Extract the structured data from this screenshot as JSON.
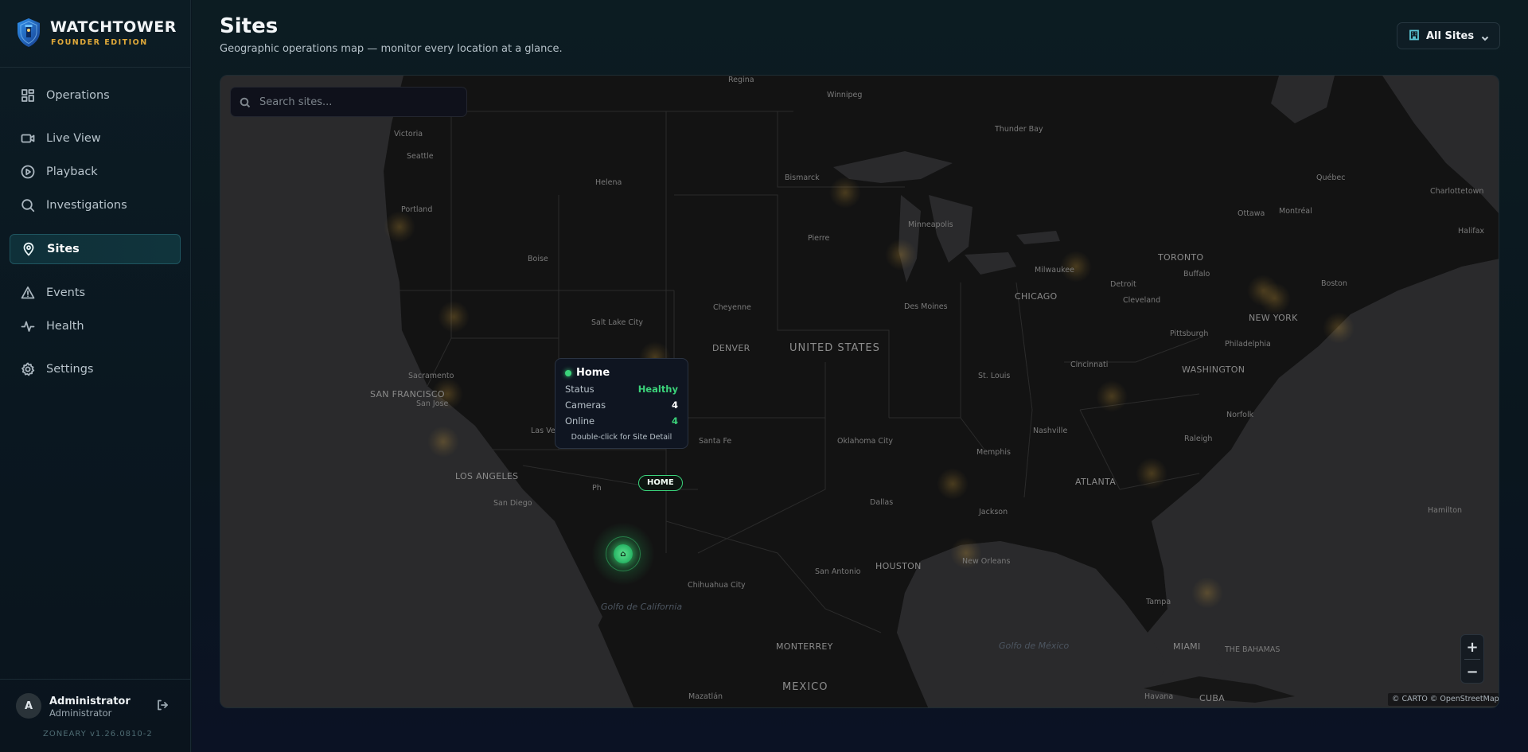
{
  "brand": {
    "name": "WATCHTOWER",
    "edition": "FOUNDER EDITION"
  },
  "nav": {
    "items": [
      {
        "label": "Operations",
        "icon": "grid-icon"
      },
      {
        "label": "Live View",
        "icon": "video-camera-icon"
      },
      {
        "label": "Playback",
        "icon": "play-circle-icon"
      },
      {
        "label": "Investigations",
        "icon": "search-icon"
      },
      {
        "label": "Sites",
        "icon": "map-pin-icon",
        "active": true
      },
      {
        "label": "Events",
        "icon": "warning-triangle-icon"
      },
      {
        "label": "Health",
        "icon": "pulse-icon"
      },
      {
        "label": "Settings",
        "icon": "gear-icon"
      }
    ]
  },
  "user": {
    "initial": "A",
    "name": "Administrator",
    "role": "Administrator",
    "version": "ZONEARY v1.26.0810-2"
  },
  "header": {
    "title": "Sites",
    "subtitle": "Geographic operations map — monitor every location at a glance.",
    "site_filter": "All Sites"
  },
  "map": {
    "search_placeholder": "Search sites...",
    "attribution": "© CARTO © OpenStreetMap",
    "zoom_in": "+",
    "zoom_out": "−",
    "labels": {
      "regina": "Regina",
      "winnipeg": "Winnipeg",
      "thunder_bay": "Thunder Bay",
      "victoria": "Victoria",
      "seattle": "Seattle",
      "helena": "Helena",
      "bismarck": "Bismarck",
      "quebec": "Québec",
      "charlottetown": "Charlottetown",
      "portland": "Portland",
      "ottawa": "Ottawa",
      "montreal": "Montréal",
      "halifax": "Halifax",
      "minneapolis": "Minneapolis",
      "pierre": "Pierre",
      "boise": "Boise",
      "toronto": "TORONTO",
      "milwaukee": "Milwaukee",
      "buffalo": "Buffalo",
      "detroit": "Detroit",
      "boston": "Boston",
      "chicago": "CHICAGO",
      "cleveland": "Cleveland",
      "cheyenne": "Cheyenne",
      "salt_lake": "Salt Lake City",
      "des_moines": "Des Moines",
      "new_york": "NEW YORK",
      "pittsburgh": "Pittsburgh",
      "philadelphia": "Philadelphia",
      "denver": "DENVER",
      "united_states": "UNITED STATES",
      "cincinnati": "Cincinnati",
      "washington": "WASHINGTON",
      "sacramento": "Sacramento",
      "st_louis": "St. Louis",
      "san_francisco": "SAN FRANCISCO",
      "san_jose": "San Jose",
      "norfolk": "Norfolk",
      "las_vegas": "Las Vegas",
      "santa_fe": "Santa Fe",
      "oklahoma": "Oklahoma City",
      "nashville": "Nashville",
      "raleigh": "Raleigh",
      "memphis": "Memphis",
      "los_angeles": "LOS ANGELES",
      "atlanta": "ATLANTA",
      "phoenix": "Ph",
      "san_diego": "San Diego",
      "dallas": "Dallas",
      "jackson": "Jackson",
      "hamilton": "Hamilton",
      "houston": "HOUSTON",
      "new_orleans": "New Orleans",
      "san_antonio": "San Antonio",
      "chihuahua": "Chihuahua City",
      "tampa": "Tampa",
      "gulf_california": "Golfo de California",
      "gulf_mexico": "Golfo de México",
      "monterrey": "MONTERREY",
      "miami": "MIAMI",
      "bahamas": "THE BAHAMAS",
      "mexico": "MEXICO",
      "havana": "Havana",
      "cuba": "CUBA",
      "mazatlan": "Mazatlán"
    }
  },
  "site": {
    "name": "Home",
    "tag": "HOME",
    "marker_glyph": "⌂",
    "status_label": "Status",
    "status_value": "Healthy",
    "cameras_label": "Cameras",
    "cameras_value": "4",
    "online_label": "Online",
    "online_value": "4",
    "hint": "Double-click for Site Detail",
    "status_color": "#3bd37a"
  },
  "colors": {
    "accent": "#5bc7d6",
    "brand_gold": "#e0a93a",
    "healthy": "#3bd37a"
  }
}
